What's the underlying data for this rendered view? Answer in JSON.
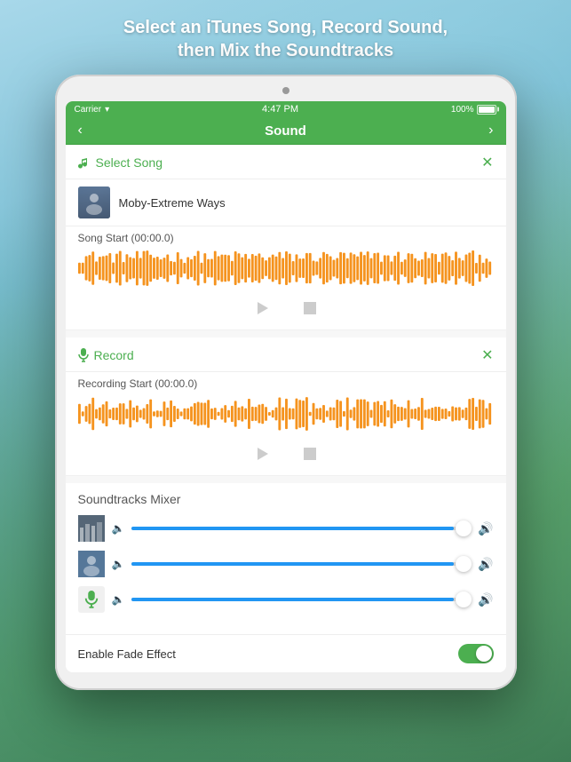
{
  "header": {
    "title": "Select an iTunes Song, Record Sound,\nthen Mix the Soundtracks",
    "line1": "Select an iTunes Song, Record Sound,",
    "line2": "then Mix the Soundtracks"
  },
  "statusBar": {
    "carrier": "Carrier",
    "time": "4:47 PM",
    "battery": "100%"
  },
  "navBar": {
    "title": "Sound",
    "backLabel": "‹",
    "forwardLabel": "›"
  },
  "selectSong": {
    "label": "Select Song",
    "closeLabel": "✕",
    "songName": "Moby-Extreme Ways",
    "waveformLabel": "Song Start (00:00.0)"
  },
  "record": {
    "label": "Record",
    "closeLabel": "✕",
    "waveformLabel": "Recording Start (00:00.0)"
  },
  "mixer": {
    "title": "Soundtracks Mixer",
    "tracks": [
      {
        "id": "city",
        "sliderValue": 95
      },
      {
        "id": "person",
        "sliderValue": 95
      },
      {
        "id": "mic",
        "sliderValue": 95
      }
    ]
  },
  "fadeEffect": {
    "label": "Enable Fade Effect",
    "enabled": true
  }
}
